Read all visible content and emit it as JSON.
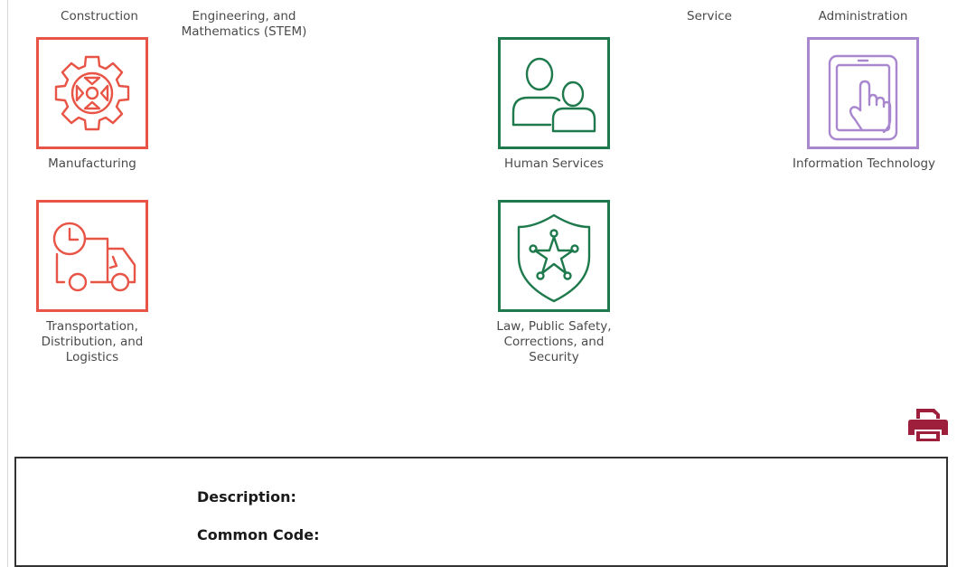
{
  "top_labels": {
    "construction": "Construction",
    "stem_line1": "Engineering, and",
    "stem_line2": "Mathematics (STEM)",
    "service": "Service",
    "administration": "Administration"
  },
  "tiles": {
    "manufacturing": {
      "label": "Manufacturing",
      "icon": "gear-icon",
      "color": "#e85445"
    },
    "human_services": {
      "label": "Human Services",
      "icon": "people-icon",
      "color": "#1e7a4c"
    },
    "information_technology": {
      "label": "Information Technology",
      "icon": "tablet-touch-icon",
      "color": "#a987cf"
    },
    "transportation": {
      "label_lines": [
        "Transportation,",
        "Distribution, and",
        "Logistics"
      ],
      "icon": "delivery-truck-clock-icon",
      "color": "#e85445"
    },
    "law": {
      "label_lines": [
        "Law, Public Safety,",
        "Corrections, and",
        "Security"
      ],
      "icon": "sheriff-badge-shield-icon",
      "color": "#1e7a4c"
    }
  },
  "print": {
    "icon": "printer-icon",
    "color": "#9e1f3c"
  },
  "details": {
    "description_label": "Description:",
    "common_code_label": "Common Code:"
  }
}
